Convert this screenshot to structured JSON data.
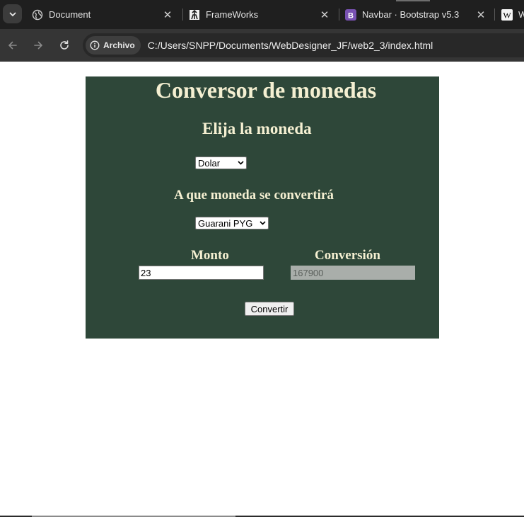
{
  "browser": {
    "tabs": [
      {
        "title": "Document",
        "icon": "globe-icon"
      },
      {
        "title": "FrameWorks",
        "icon": "frameworks-favicon-icon"
      },
      {
        "title": "Navbar · Bootstrap v5.3",
        "icon": "bootstrap-favicon-icon"
      },
      {
        "title": "W",
        "icon": "wikipedia-favicon-icon"
      }
    ],
    "omnibox": {
      "chip_label": "Archivo",
      "url": "C:/Users/SNPP/Documents/WebDesigner_JF/web2_3/index.html"
    },
    "colors": {
      "tabstrip": "#1f1f1f",
      "toolbar": "#353535",
      "bootstrap": "#7952b3"
    }
  },
  "page": {
    "title": "Conversor de monedas",
    "choose_label": "Elija la moneda",
    "source_currency": "Dolar",
    "target_label": "A que moneda se convertirá",
    "target_currency": "Guarani PYG",
    "amount_label": "Monto",
    "amount_value": "23",
    "conversion_label": "Conversión",
    "conversion_value": "167900",
    "convert_button": "Convertir",
    "colors": {
      "panel": "#2e4739",
      "text": "#f5f0d2"
    }
  }
}
